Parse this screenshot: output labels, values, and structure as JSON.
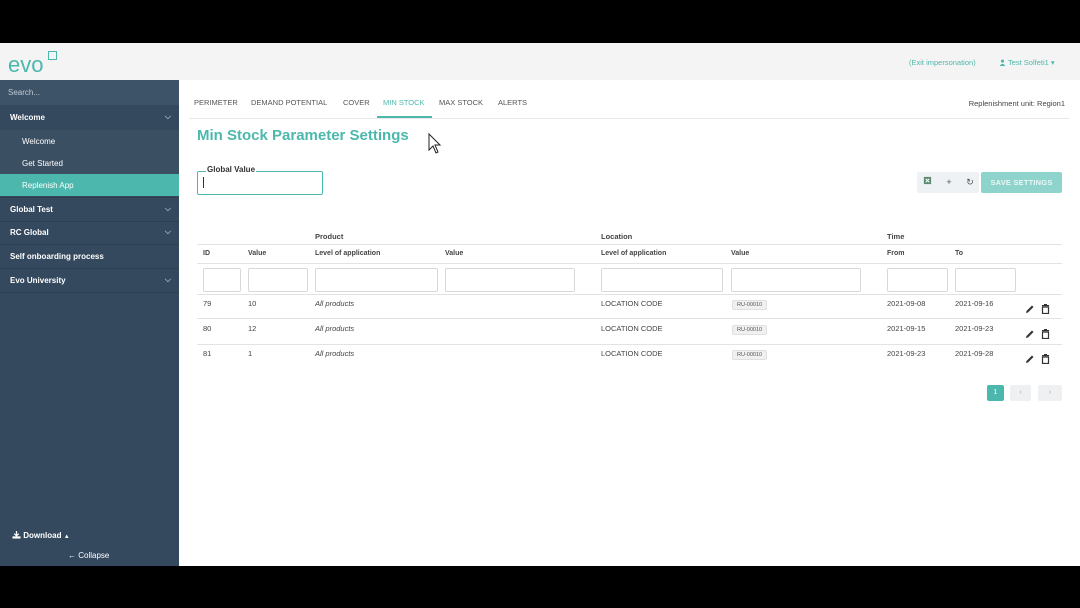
{
  "header": {
    "logo_text": "evo",
    "exit_link": "(Exit impersonation)",
    "user_name": "Test Solfeti1"
  },
  "sidebar": {
    "search_placeholder": "Search...",
    "items": [
      {
        "label": "Welcome",
        "expanded": true,
        "children": [
          "Welcome",
          "Get Started",
          "Replenish App"
        ]
      },
      {
        "label": "Global Test"
      },
      {
        "label": "RC Global"
      },
      {
        "label": "Self onboarding process"
      },
      {
        "label": "Evo University"
      }
    ],
    "active_child": "Replenish App",
    "download_label": "Download",
    "collapse_label": "Collapse"
  },
  "tabs": [
    "PERIMETER",
    "DEMAND POTENTIAL",
    "COVER",
    "MIN STOCK",
    "MAX STOCK",
    "ALERTS"
  ],
  "active_tab": "MIN STOCK",
  "replenishment_unit": "Replenishment unit: Region1",
  "page_title": "Min Stock Parameter Settings",
  "global_value": {
    "label": "Global Value",
    "value": ""
  },
  "toolbar": {
    "save_label": "SAVE SETTINGS"
  },
  "table": {
    "groups": {
      "product": "Product",
      "location": "Location",
      "time": "Time"
    },
    "columns": [
      "ID",
      "Value",
      "Level of application",
      "Value",
      "Level of application",
      "Value",
      "From",
      "To"
    ],
    "rows": [
      {
        "id": "79",
        "value": "10",
        "product_level": "All products",
        "product_value": "",
        "location_level": "LOCATION CODE",
        "location_value": "RU-00010",
        "from": "2021-09-08",
        "to": "2021-09-16"
      },
      {
        "id": "80",
        "value": "12",
        "product_level": "All products",
        "product_value": "",
        "location_level": "LOCATION CODE",
        "location_value": "RU-00010",
        "from": "2021-09-15",
        "to": "2021-09-23"
      },
      {
        "id": "81",
        "value": "1",
        "product_level": "All products",
        "product_value": "",
        "location_level": "LOCATION CODE",
        "location_value": "RU-00010",
        "from": "2021-09-23",
        "to": "2021-09-28"
      }
    ]
  },
  "pagination": {
    "current_page": "1"
  },
  "colors": {
    "accent": "#4cb8ad",
    "sidebar": "#34495e"
  }
}
